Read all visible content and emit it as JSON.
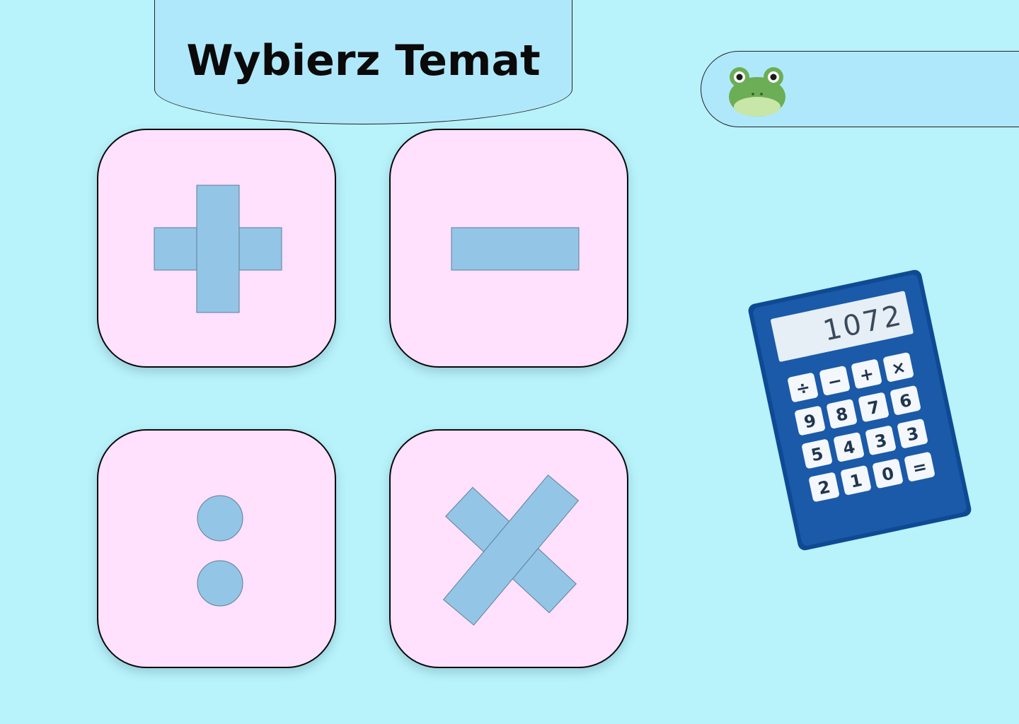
{
  "header": {
    "title": "Wybierz Temat"
  },
  "profile": {
    "avatar_icon": "frog-avatar-icon"
  },
  "topics": [
    {
      "icon": "plus-icon"
    },
    {
      "icon": "minus-icon"
    },
    {
      "icon": "division-icon"
    },
    {
      "icon": "multiply-icon"
    }
  ],
  "calculator": {
    "display": "1072",
    "keys": [
      "÷",
      "−",
      "+",
      "×",
      "9",
      "8",
      "7",
      "6",
      "5",
      "4",
      "3",
      "3",
      "2",
      "1",
      "0",
      "="
    ]
  },
  "colors": {
    "background": "#b8f2fa",
    "banner": "#b0e8fb",
    "tile": "#ffe0fd",
    "symbol": "#93c5e6",
    "calculator_body": "#1a5aa8"
  }
}
